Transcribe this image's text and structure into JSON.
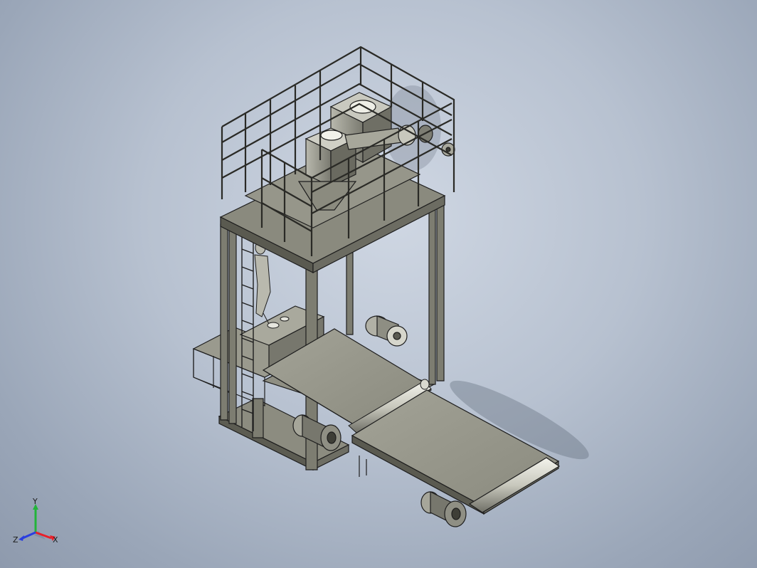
{
  "triad": {
    "x_label": "X",
    "y_label": "Y",
    "z_label": "Z",
    "x_color": "#e8202a",
    "y_color": "#22b43a",
    "z_color": "#2a3ee0"
  },
  "colors": {
    "steel_face": "#8a8a7c",
    "steel_dark": "#55554b",
    "belt": "#9c9c90",
    "outline": "#1e1e1e"
  }
}
